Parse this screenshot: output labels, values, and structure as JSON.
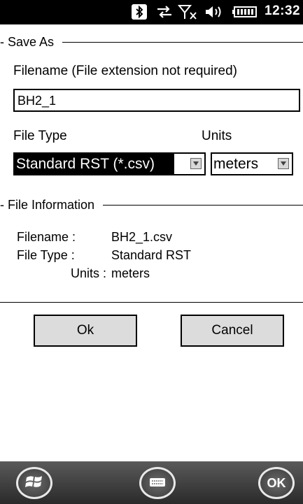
{
  "status_bar": {
    "time": "12:32",
    "icons": [
      "bluetooth-icon",
      "data-transfer-icon",
      "signal-no-service-icon",
      "volume-icon",
      "battery-icon"
    ]
  },
  "save_as": {
    "group_label": "Save As",
    "filename_label": "Filename (File extension not required)",
    "filename_value": "BH2_1",
    "file_type_label": "File Type",
    "units_label": "Units",
    "file_type_selected": "Standard RST (*.csv)",
    "units_selected": "meters"
  },
  "file_info": {
    "group_label": "File Information",
    "filename_label": "Filename :",
    "filename_value": "BH2_1.csv",
    "file_type_label": "File Type :",
    "file_type_value": "Standard RST",
    "units_label": "Units :",
    "units_value": "meters"
  },
  "buttons": {
    "ok": "Ok",
    "cancel": "Cancel"
  },
  "taskbar": {
    "ok_label": "OK",
    "icons": [
      "start-icon",
      "keyboard-icon"
    ]
  },
  "colors": {
    "selection_bg": "#000000",
    "button_bg": "#dcdcdc",
    "status_bar_bg": "#000000"
  }
}
